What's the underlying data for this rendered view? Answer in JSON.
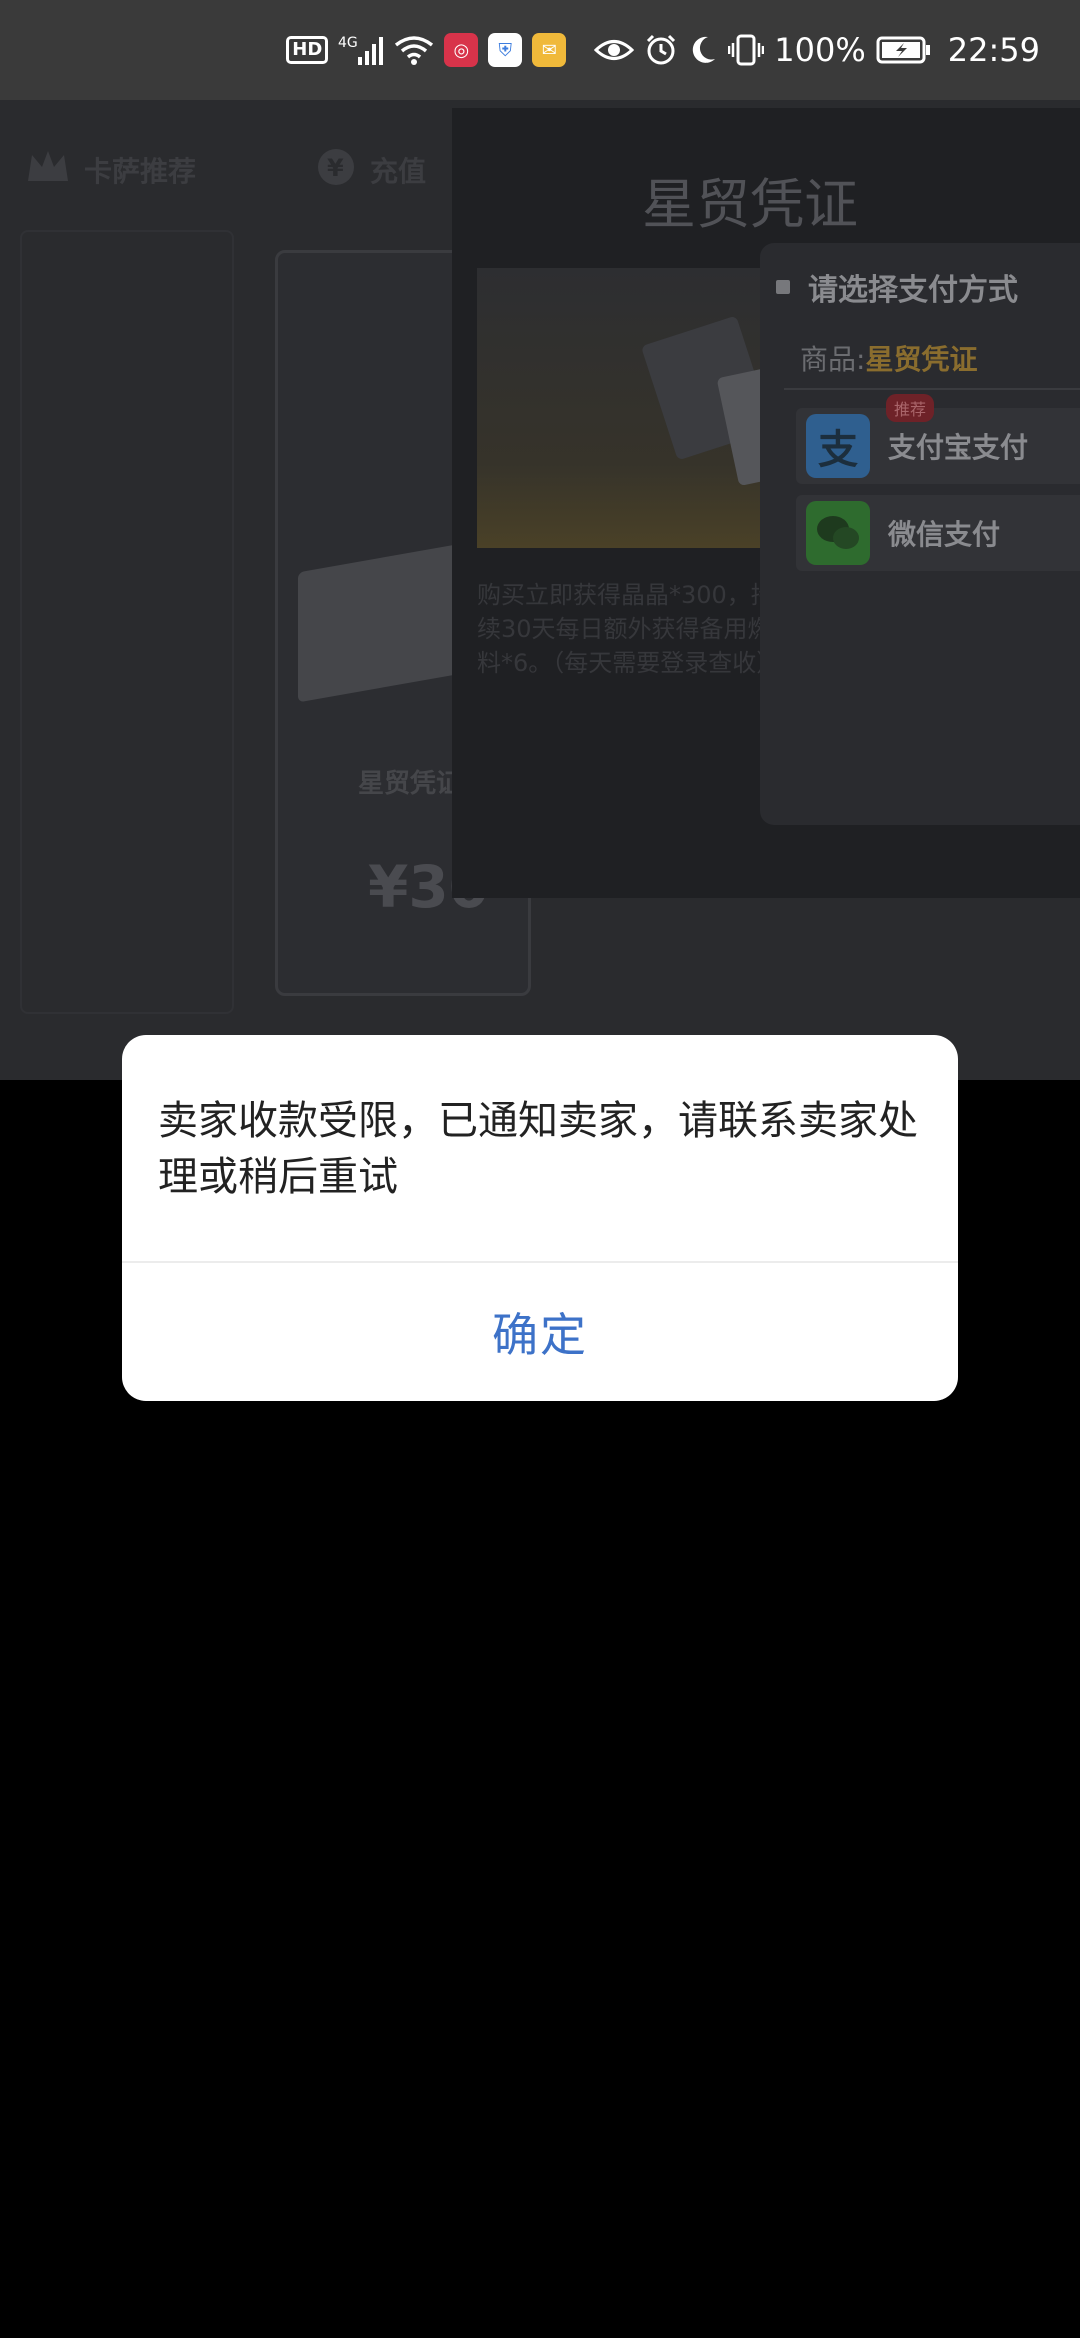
{
  "status_bar": {
    "hd_label": "HD",
    "network_label": "4G",
    "battery_percent": "100%",
    "time": "22:59",
    "icons": [
      "hd-icon",
      "4g-signal-icon",
      "wifi-icon",
      "app-red-icon",
      "shield-icon",
      "mail-icon",
      "eye-icon",
      "alarm-icon",
      "moon-icon",
      "vibrate-icon",
      "battery-icon"
    ],
    "colors": {
      "background": "#3a3a3a",
      "app_red": "#d8334a",
      "shield_blue": "#3d7dde",
      "mail_yellow": "#f0b93a"
    }
  },
  "background_app": {
    "tabs": [
      {
        "label": "卡萨推荐",
        "icon": "crown-icon"
      },
      {
        "label": "充值",
        "icon": "yen-icon"
      }
    ],
    "product_card": {
      "name": "星贸凭证",
      "price": "¥30"
    },
    "detail": {
      "title": "星贸凭证",
      "description": "购买立即获得晶晶*300，持续30天每日额外获得备用燃料*6。（每天需要登录查收）"
    },
    "payment": {
      "title": "请选择支付方式",
      "product_label": "商品:",
      "product_name": "星贸凭证",
      "options": [
        {
          "label": "支付宝支付",
          "icon": "alipay-icon",
          "tag": "推荐",
          "color": "#1a78d6"
        },
        {
          "label": "微信支付",
          "icon": "wechat-icon",
          "color": "#2aa52a"
        }
      ]
    }
  },
  "dialog": {
    "message": "卖家收款受限，已通知卖家，请联系卖家处理或稍后重试",
    "confirm_label": "确定",
    "confirm_color": "#3d72c8"
  }
}
